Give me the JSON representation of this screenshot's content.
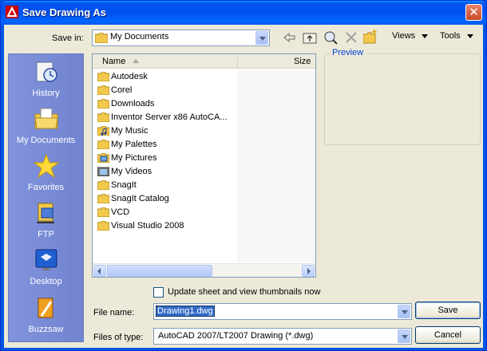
{
  "window": {
    "title": "Save Drawing As",
    "close_glyph": "✕"
  },
  "toolbar": {
    "save_in_label": "Save in:",
    "save_in_value": "My Documents",
    "views_label": "Views",
    "tools_label": "Tools",
    "icons": [
      "back-icon",
      "up-folder-icon",
      "search-web-icon",
      "delete-icon",
      "new-folder-icon"
    ]
  },
  "places": [
    {
      "label": "History",
      "icon": "history-icon"
    },
    {
      "label": "My Documents",
      "icon": "my-documents-icon"
    },
    {
      "label": "Favorites",
      "icon": "favorites-icon"
    },
    {
      "label": "FTP",
      "icon": "ftp-icon"
    },
    {
      "label": "Desktop",
      "icon": "desktop-icon"
    },
    {
      "label": "Buzzsaw",
      "icon": "buzzsaw-icon"
    }
  ],
  "file_list": {
    "columns": {
      "name": "Name",
      "size": "Size"
    },
    "items": [
      {
        "name": "Autodesk",
        "type": "folder"
      },
      {
        "name": "Corel",
        "type": "folder"
      },
      {
        "name": "Downloads",
        "type": "folder"
      },
      {
        "name": "Inventor Server x86 AutoCA...",
        "type": "folder"
      },
      {
        "name": "My Music",
        "type": "music-folder"
      },
      {
        "name": "My Palettes",
        "type": "folder"
      },
      {
        "name": "My Pictures",
        "type": "pictures-folder"
      },
      {
        "name": "My Videos",
        "type": "videos-folder"
      },
      {
        "name": "SnagIt",
        "type": "folder"
      },
      {
        "name": "SnagIt Catalog",
        "type": "folder"
      },
      {
        "name": "VCD",
        "type": "folder"
      },
      {
        "name": "Visual Studio 2008",
        "type": "folder"
      }
    ]
  },
  "preview": {
    "label": "Preview"
  },
  "options": {
    "update_thumbnails_label": "Update sheet and view thumbnails now",
    "update_thumbnails_checked": false
  },
  "form": {
    "file_name_label": "File name:",
    "file_name_value": "Drawing1.dwg",
    "file_type_label": "Files of type:",
    "file_type_value": "AutoCAD 2007/LT2007 Drawing (*.dwg)"
  },
  "buttons": {
    "save": "Save",
    "cancel": "Cancel"
  },
  "colors": {
    "title_bar": "#0054e3",
    "dialog_bg": "#ece9d8",
    "places_bg": "#7b8fd8",
    "selection": "#316ac5",
    "folder": "#f2c94c"
  }
}
